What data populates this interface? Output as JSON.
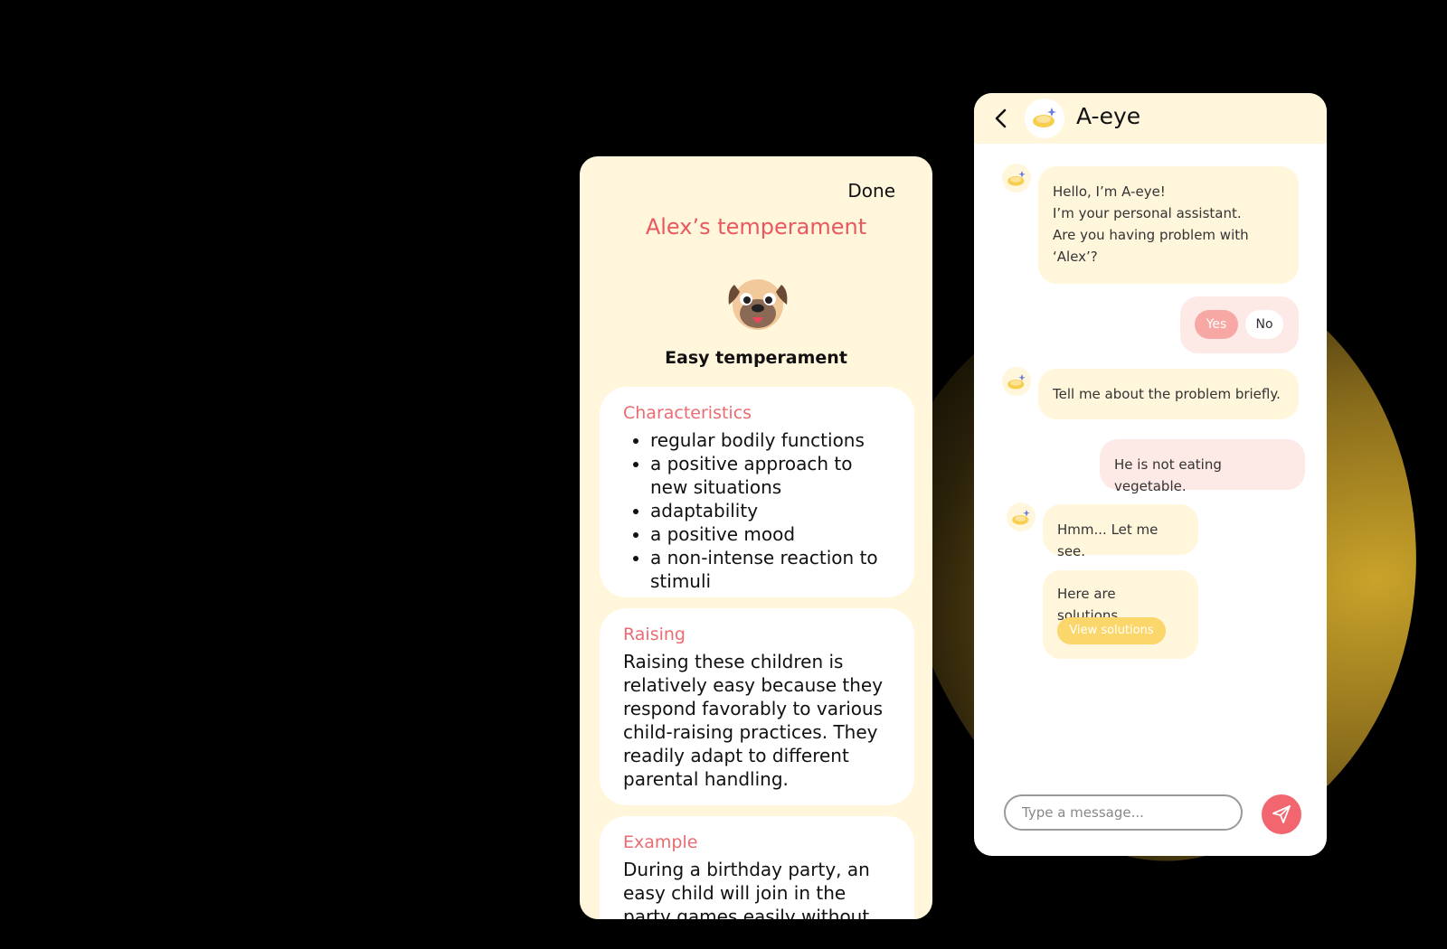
{
  "temperament_screen": {
    "done_label": "Done",
    "title": "Alex’s temperament",
    "temperament_name": "Easy temperament",
    "icon": "pug-face-icon",
    "characteristics": {
      "heading": "Characteristics",
      "items": [
        "regular bodily functions",
        "a positive approach to new situations",
        "adaptability",
        "a positive mood",
        "a non-intense reaction to stimuli"
      ]
    },
    "raising": {
      "heading": "Raising",
      "text": "Raising these children is relatively easy because they respond favorably to various child-raising practices. They readily adapt to different parental handling."
    },
    "example": {
      "heading": "Example",
      "text": "During a birthday party, an easy child will join in the party games easily without any fuss."
    }
  },
  "chat_screen": {
    "header_title": "A-eye",
    "messages": {
      "greeting_lines": [
        "Hello, I’m A-eye!",
        "I’m your personal assistant.",
        "Are you having problem with",
        "‘Alex’?"
      ],
      "quick_reply_yes": "Yes",
      "quick_reply_no": "No",
      "bot_prompt": "Tell me about the problem briefly.",
      "user_reply": "He is not eating vegetable.",
      "bot_thinking": "Hmm... Let me see.",
      "bot_solutions": "Here are solutions.",
      "view_solutions_label": "View solutions"
    },
    "input_placeholder": "Type a message...",
    "colors": {
      "accent": "#f26670",
      "bot_bubble": "#fff6dc",
      "user_bubble": "#fde9e6",
      "button_yellow": "#fbd66a"
    }
  }
}
